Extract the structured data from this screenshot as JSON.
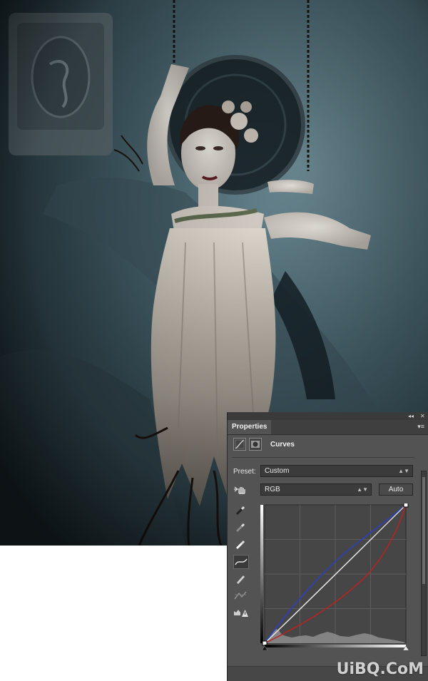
{
  "panel": {
    "collapse_label": "◂◂",
    "close_label": "✕",
    "tab_label": "Properties",
    "menu_label": "▾≡",
    "title": "Curves",
    "preset_label": "Preset:",
    "preset_value": "Custom",
    "channel_value": "RGB",
    "auto_label": "Auto"
  },
  "watermark": "UiBQ.CoM",
  "colors": {
    "panel_bg": "#535353",
    "curve_blue": "#2a3fd0",
    "curve_red": "#c0201e",
    "curve_rgb": "#f0f0f0"
  },
  "icons": [
    "curves-adjustment-icon",
    "layer-mask-icon",
    "on-image-adjust-hand-icon",
    "sample-black-point-icon",
    "sample-gray-point-icon",
    "sample-white-point-icon",
    "curve-points-icon",
    "pencil-draw-icon",
    "smooth-curve-icon",
    "clipping-warning-icon"
  ]
}
